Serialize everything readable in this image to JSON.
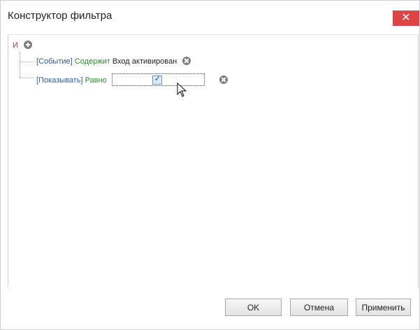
{
  "window": {
    "title": "Конструктор фильтра",
    "close_icon": "close-icon"
  },
  "filter": {
    "root_operator": "И",
    "conditions": [
      {
        "field": "[Событие]",
        "operator": "Содержит",
        "value": "Вход активирован"
      },
      {
        "field": "[Показывать]",
        "operator": "Равно",
        "value_checked": true
      }
    ]
  },
  "footer": {
    "ok_label": "OK",
    "cancel_label": "Отмена",
    "apply_label": "Применить"
  },
  "colors": {
    "field": "#2f5aa8",
    "operator": "#2f8a2f",
    "root_operator": "#c0392b",
    "close_button": "#e04343"
  }
}
